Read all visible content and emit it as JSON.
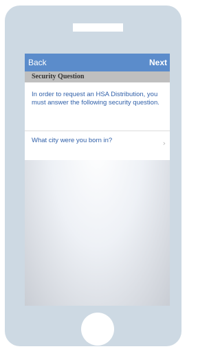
{
  "nav": {
    "back_label": "Back",
    "next_label": "Next"
  },
  "section": {
    "title": "Security Question"
  },
  "info": {
    "text": "In order to request an HSA Distribution, you must answer the following security question."
  },
  "question": {
    "text": "What city were you born in?",
    "chevron": "›"
  },
  "colors": {
    "navbar": "#5b8ccb",
    "link_text": "#2f5fa8",
    "section_header": "#bfbfbf",
    "phone_body": "#cdd9e3"
  },
  "icons": {
    "chevron": "chevron-right-icon"
  }
}
